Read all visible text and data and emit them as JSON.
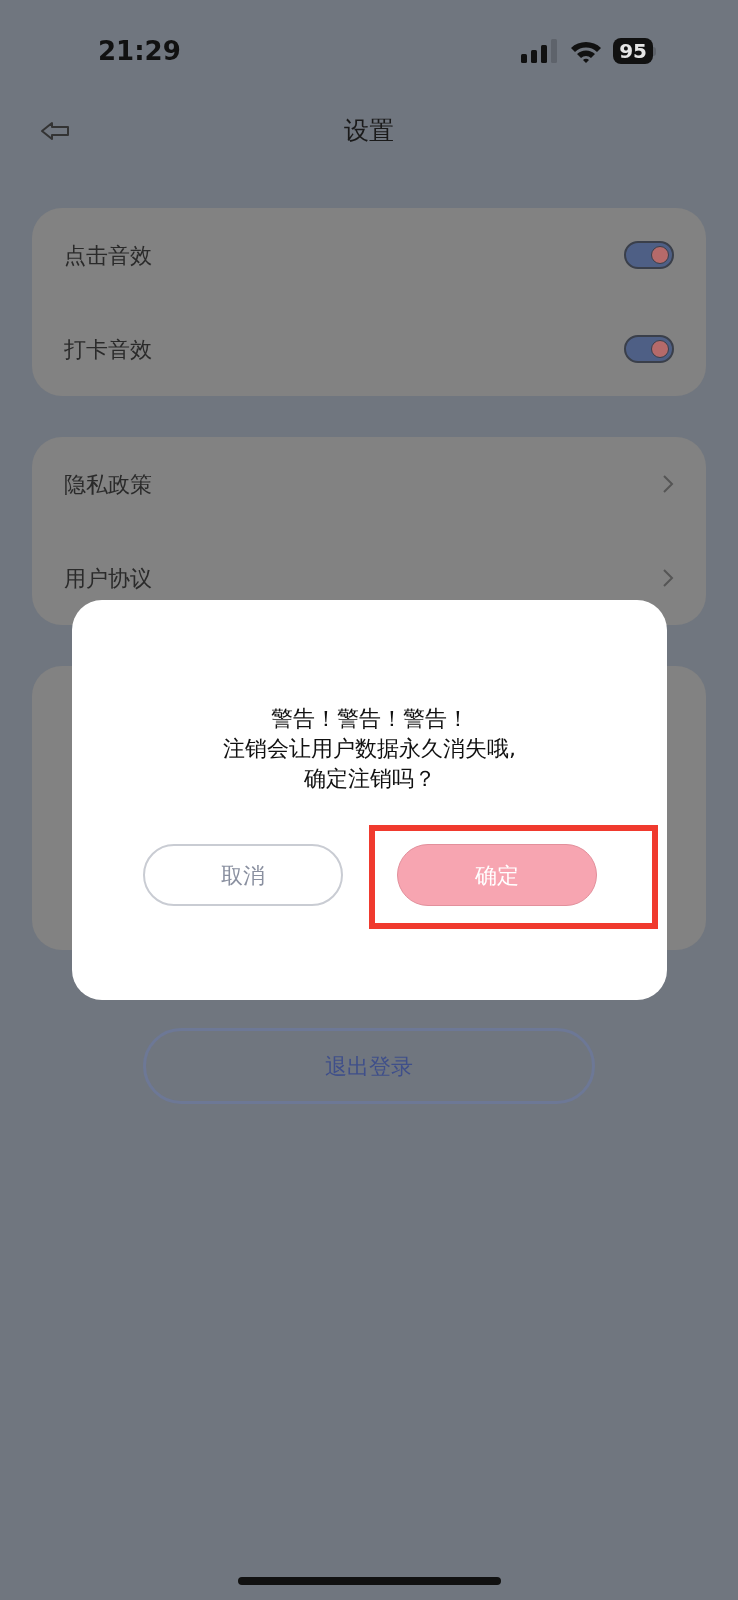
{
  "status_bar": {
    "time": "21:29",
    "battery": "95"
  },
  "header": {
    "title": "设置"
  },
  "sound_settings": [
    {
      "label": "点击音效",
      "on": true
    },
    {
      "label": "打卡音效",
      "on": true
    }
  ],
  "links": [
    {
      "label": "隐私政策"
    },
    {
      "label": "用户协议"
    }
  ],
  "logout_button": "退出登录",
  "dialog": {
    "message": [
      "警告！警告！警告！",
      "注销会让用户数据永久消失哦,",
      "确定注销吗？"
    ],
    "cancel": "取消",
    "confirm": "确定"
  }
}
